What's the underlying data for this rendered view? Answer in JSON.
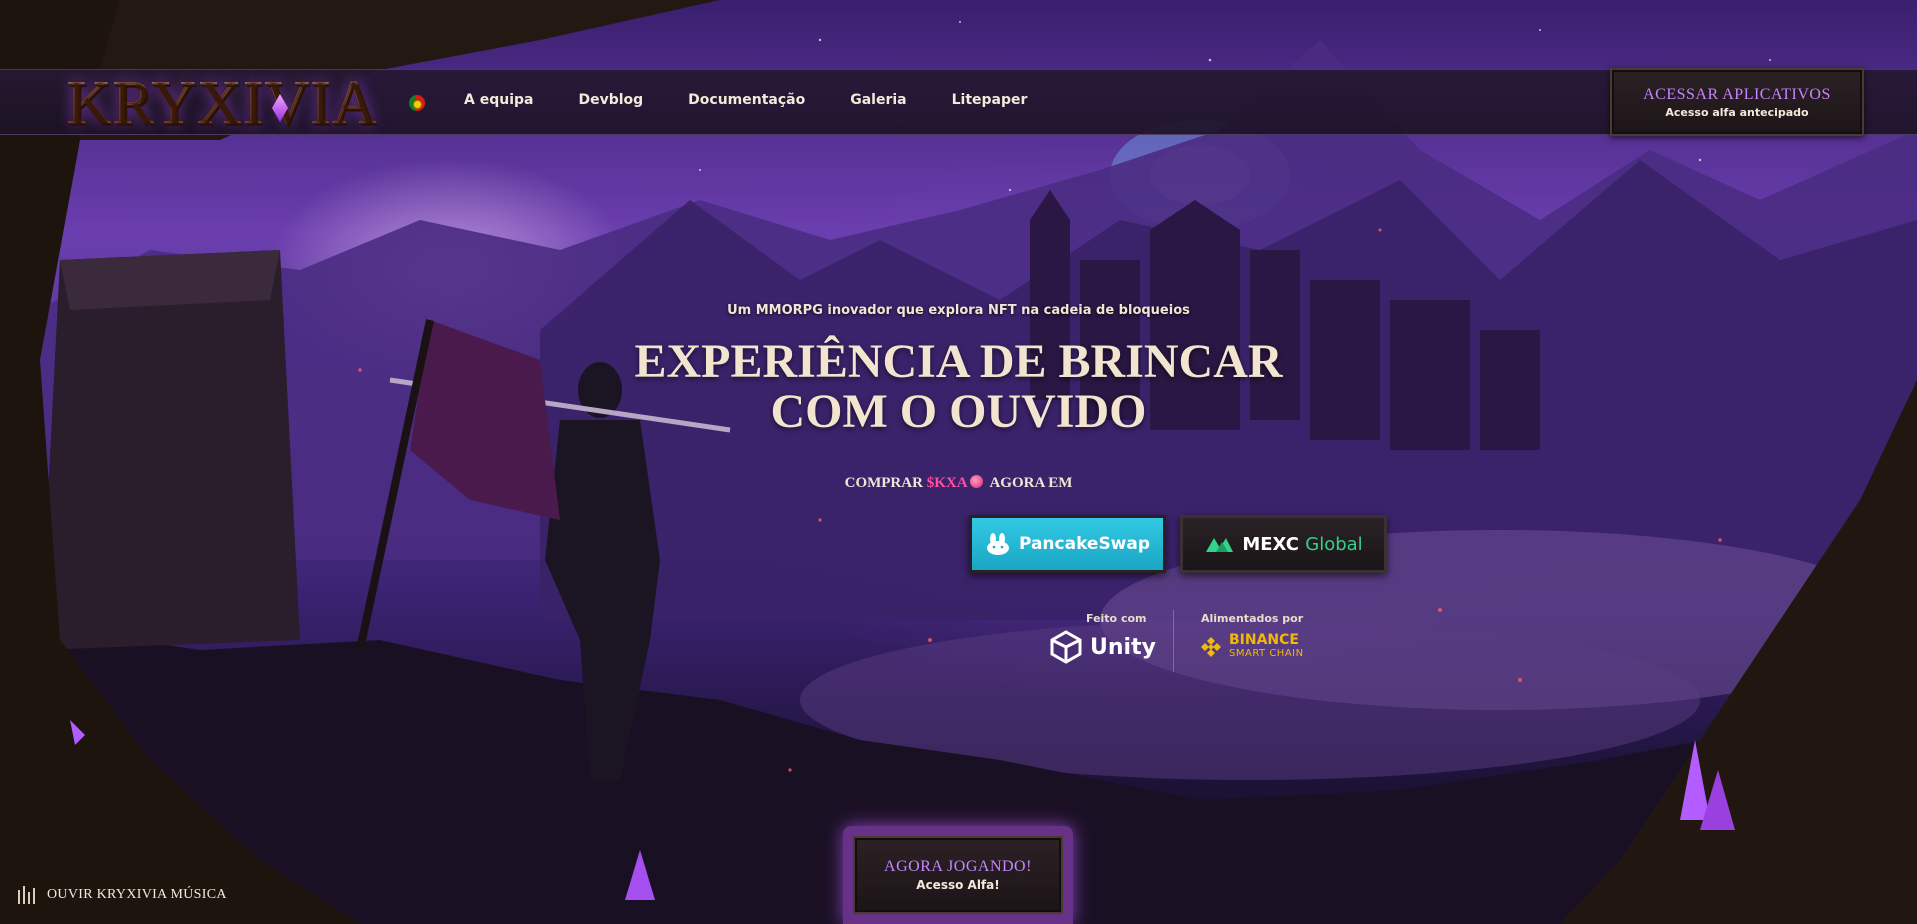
{
  "brand": {
    "logo_text": "KRYXIVIA"
  },
  "nav": {
    "language_flag": "portugal-flag",
    "links": [
      "A equipa",
      "Devblog",
      "Documentação",
      "Galeria",
      "Litepaper"
    ]
  },
  "access_button": {
    "title": "ACESSAR APLICATIVOS",
    "subtitle": "Acesso alfa antecipado"
  },
  "hero": {
    "tagline": "Um MMORPG inovador que explora NFT na cadeia de bloqueios",
    "headline_line1": "EXPERIÊNCIA DE BRINCAR",
    "headline_line2": "COM O OUVIDO",
    "buy_prefix": "COMPRAR",
    "token": "$KXA",
    "buy_suffix": "AGORA EM"
  },
  "exchanges": {
    "pancakeswap_label": "PancakeSwap",
    "mexc_label_1": "MEXC",
    "mexc_label_2": "Global"
  },
  "partners": {
    "made_with_label": "Feito com",
    "made_with_name": "Unity",
    "powered_by_label": "Alimentados por",
    "powered_by_name_1": "BINANCE",
    "powered_by_name_2": "SMART CHAIN"
  },
  "play_button": {
    "title": "AGORA JOGANDO!",
    "subtitle": "Acesso Alfa!"
  },
  "music": {
    "label": "OUVIR KRYXIVIA MÚSICA"
  },
  "colors": {
    "accent_purple": "#c684ff",
    "token_pink": "#ff4fa0",
    "pancake_cyan": "#32c9e4",
    "mexc_green": "#30d388",
    "binance_yellow": "#f0b90b"
  }
}
